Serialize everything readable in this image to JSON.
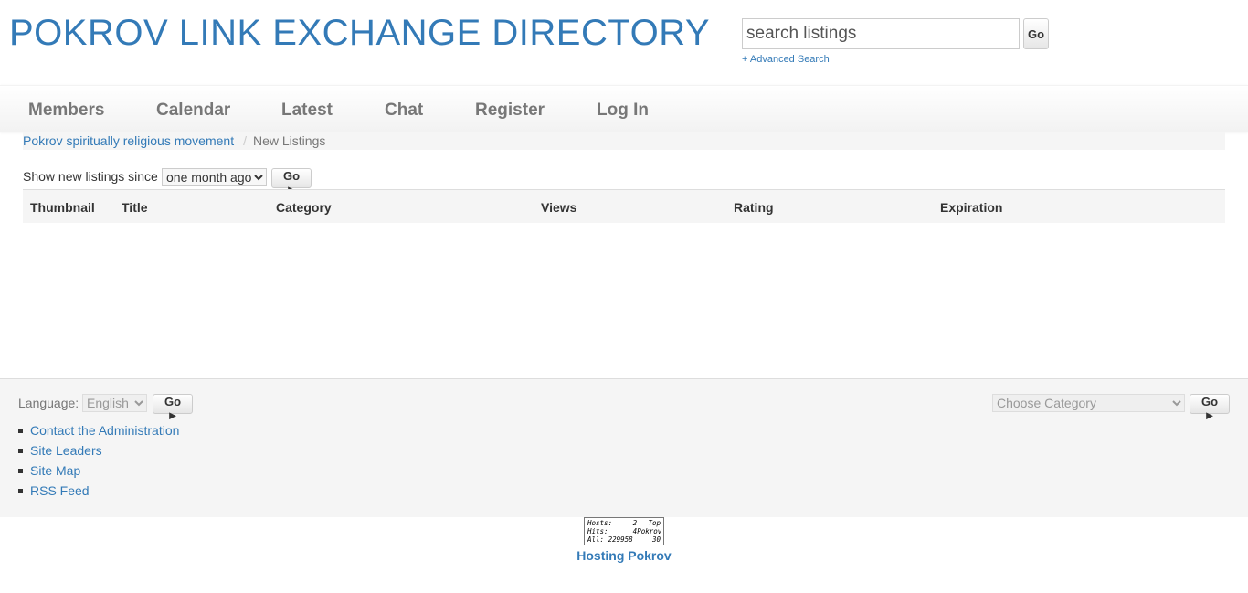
{
  "header": {
    "site_title": "POKROV LINK EXCHANGE DIRECTORY",
    "search_placeholder": "search listings",
    "search_go": "Go",
    "advanced_search": "+ Advanced Search"
  },
  "nav": {
    "items": [
      "Members",
      "Calendar",
      "Latest",
      "Chat",
      "Register",
      "Log In"
    ]
  },
  "breadcrumb": {
    "parent": "Pokrov spiritually religious movement",
    "separator": "/",
    "current": "New Listings"
  },
  "filter": {
    "label": "Show new listings since",
    "selected": "one month ago",
    "go": "Go ►"
  },
  "table": {
    "columns": [
      "Thumbnail",
      "Title",
      "Category",
      "Views",
      "Rating",
      "Expiration"
    ],
    "rows": []
  },
  "footer": {
    "language_label": "Language:",
    "language_selected": "English",
    "language_go": "Go ►",
    "category_selected": "Choose Category",
    "category_go": "Go ►",
    "links": [
      "Contact the Administration",
      "Site Leaders",
      "Site Map",
      "RSS Feed"
    ]
  },
  "counter": {
    "hosts_label": "Hosts:",
    "hosts_value": "2",
    "hits_label": "Hits:",
    "hits_value": "4",
    "all_label": "All:",
    "all_value": "229958",
    "badge_line1": "Top",
    "badge_line2": "Pokrov",
    "badge_line3": "30"
  },
  "hosting_link": "Hosting Pokrov",
  "colors": {
    "link": "#337ab7",
    "nav_text": "#777777",
    "footer_bg": "#f5f5f5"
  }
}
